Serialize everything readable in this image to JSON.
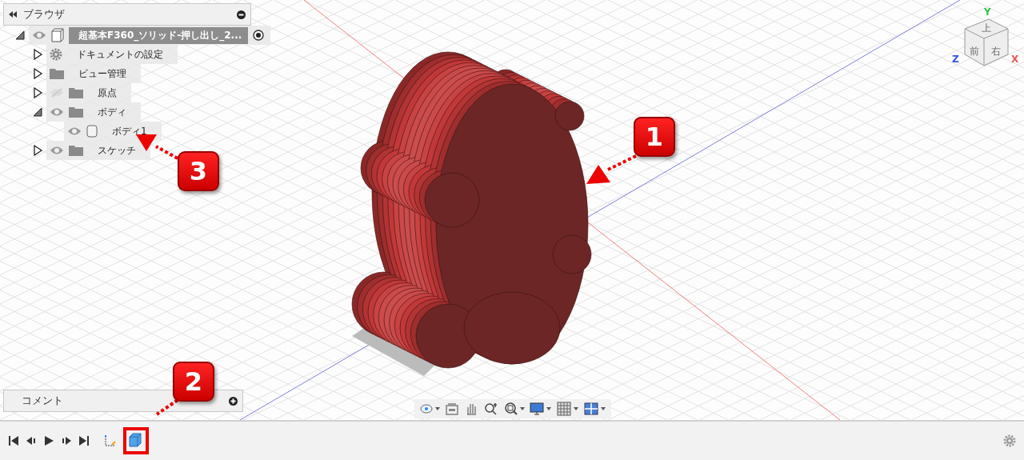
{
  "browser": {
    "title": "ブラウザ",
    "root": {
      "label": "超基本F360_ソリッド-押し出し_2...",
      "kind": "component",
      "visible": true,
      "expanded": true,
      "active": true,
      "children": [
        {
          "label": "ドキュメントの設定",
          "kind": "gear",
          "expanded": false
        },
        {
          "label": "ビュー管理",
          "kind": "folder",
          "expanded": false
        },
        {
          "label": "原点",
          "kind": "folder",
          "visible": false,
          "expanded": false
        },
        {
          "label": "ボディ",
          "kind": "folder",
          "visible": true,
          "expanded": true,
          "children": [
            {
              "label": "ボディ1",
              "kind": "body",
              "visible": true
            }
          ]
        },
        {
          "label": "スケッチ",
          "kind": "folder",
          "visible": true,
          "expanded": false
        }
      ]
    }
  },
  "view_cube": {
    "faces": [
      "上",
      "前",
      "右"
    ],
    "axes": [
      {
        "label": "Y",
        "color": "#2fc44a"
      },
      {
        "label": "Z",
        "color": "#3355ee"
      },
      {
        "label": "X",
        "color": "#ee5555"
      }
    ]
  },
  "comments": {
    "title": "コメント"
  },
  "callouts": [
    {
      "label": "1"
    },
    {
      "label": "2"
    },
    {
      "label": "3"
    }
  ]
}
